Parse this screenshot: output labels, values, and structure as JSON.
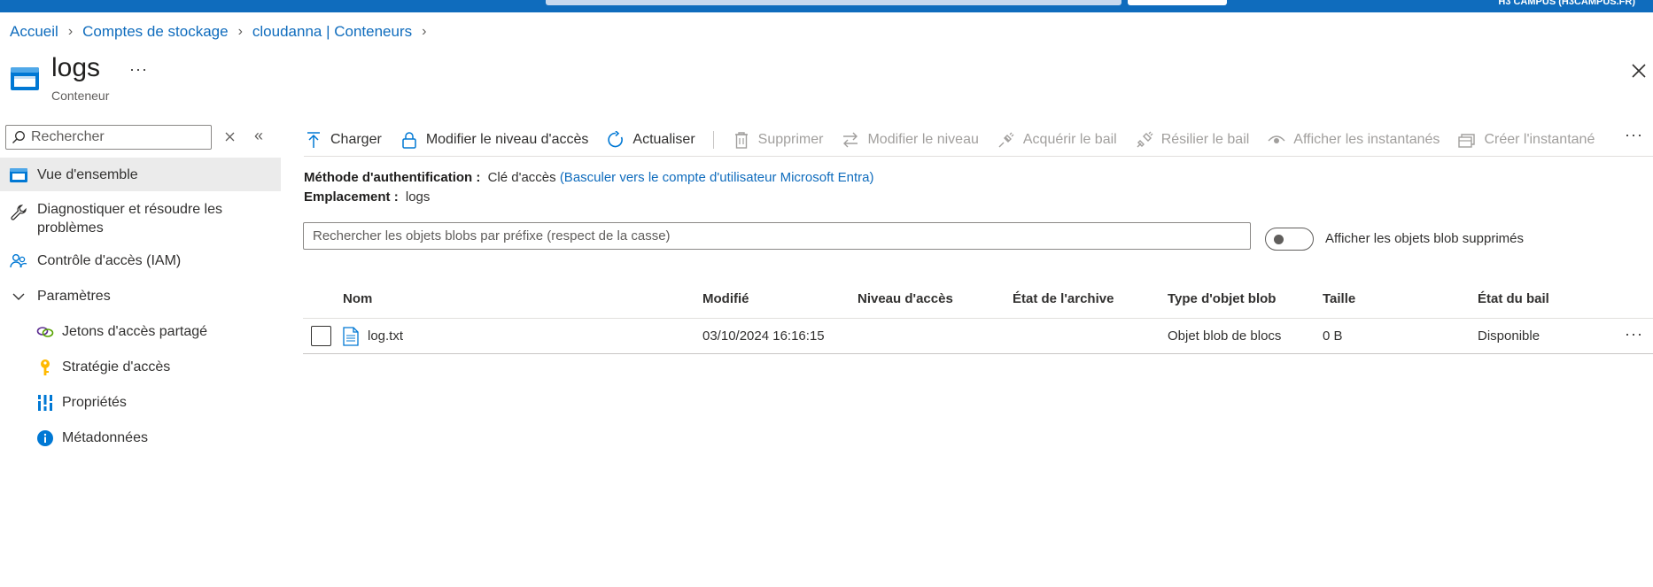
{
  "topbar": {
    "tenant": "H3 CAMPUS (H3CAMPUS.FR)"
  },
  "breadcrumb": {
    "items": [
      "Accueil",
      "Comptes de stockage",
      "cloudanna | Conteneurs"
    ]
  },
  "header": {
    "title": "logs",
    "subtitle": "Conteneur",
    "more": "···"
  },
  "sidebar": {
    "search_placeholder": "Rechercher",
    "items": [
      {
        "label": "Vue d'ensemble",
        "icon": "container-icon",
        "active": true
      },
      {
        "label": "Diagnostiquer et résoudre les problèmes",
        "icon": "wrench-icon"
      },
      {
        "label": "Contrôle d'accès (IAM)",
        "icon": "people-icon"
      },
      {
        "label": "Paramètres",
        "icon": "chevron-down-icon"
      },
      {
        "label": "Jetons d'accès partagé",
        "icon": "link-icon"
      },
      {
        "label": "Stratégie d'accès",
        "icon": "key-icon"
      },
      {
        "label": "Propriétés",
        "icon": "bars-icon"
      },
      {
        "label": "Métadonnées",
        "icon": "info-icon"
      }
    ]
  },
  "toolbar": {
    "upload": "Charger",
    "change_access": "Modifier le niveau d'accès",
    "refresh": "Actualiser",
    "delete": "Supprimer",
    "change_tier": "Modifier le niveau",
    "acquire_lease": "Acquérir le bail",
    "break_lease": "Résilier le bail",
    "view_snapshots": "Afficher les instantanés",
    "create_snapshot": "Créer l'instantané",
    "more": "···"
  },
  "info": {
    "auth_label": "Méthode d'authentification :",
    "auth_value": "Clé d'accès",
    "auth_link": "(Basculer vers le compte d'utilisateur Microsoft Entra)",
    "location_label": "Emplacement :",
    "location_value": "logs"
  },
  "blob_search": {
    "placeholder": "Rechercher les objets blobs par préfixe (respect de la casse)"
  },
  "toggle": {
    "label": "Afficher les objets blob supprimés",
    "on": false
  },
  "table": {
    "columns": [
      "Nom",
      "Modifié",
      "Niveau d'accès",
      "État de l'archive",
      "Type d'objet blob",
      "Taille",
      "État du bail"
    ],
    "rows": [
      {
        "name": "log.txt",
        "modified": "03/10/2024 16:16:15",
        "access_tier": "",
        "archive_state": "",
        "blob_type": "Objet blob de blocs",
        "size": "0 B",
        "lease_state": "Disponible",
        "more": "···"
      }
    ]
  },
  "colors": {
    "accent": "#0f6cbd",
    "topbar": "#0f6cbd",
    "disabled_text": "#a19f9d"
  }
}
